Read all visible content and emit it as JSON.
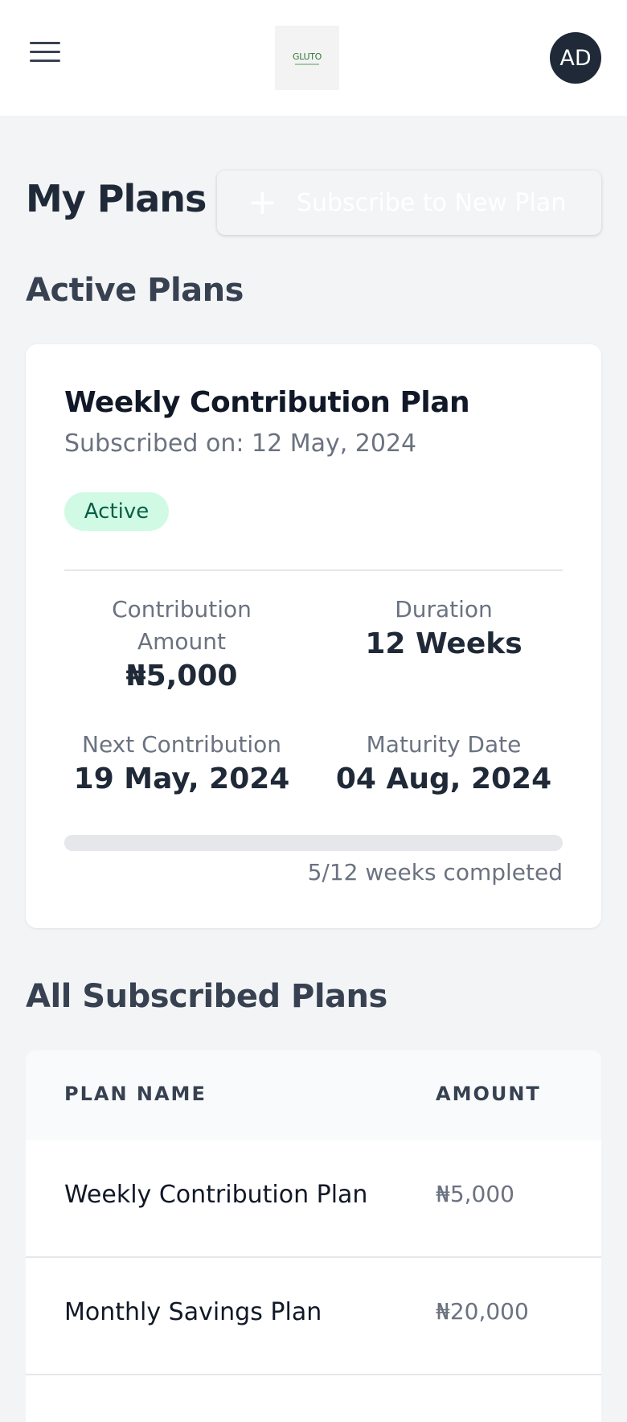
{
  "header": {
    "logo_text": "GLUTO",
    "avatar_initials": "AD"
  },
  "page": {
    "title": "My Plans",
    "subscribe_button": "Subscribe to New Plan"
  },
  "active_section": {
    "title": "Active Plans",
    "plan": {
      "name": "Weekly Contribution Plan",
      "subscribed_on": "Subscribed on: 12 May, 2024",
      "status": "Active",
      "contribution_label_line1": "Contribution",
      "contribution_label_line2": "Amount",
      "contribution_value": "₦5,000",
      "duration_label": "Duration",
      "duration_value": "12 Weeks",
      "next_label": "Next Contribution",
      "next_value": "19 May, 2024",
      "maturity_label": "Maturity Date",
      "maturity_value": "04 Aug, 2024",
      "progress_fraction": 0.4167,
      "progress_text": "5/12 weeks completed"
    }
  },
  "all_section": {
    "title": "All Subscribed Plans",
    "columns": [
      "PLAN NAME",
      "AMOUNT"
    ],
    "rows": [
      {
        "name": "Weekly Contribution Plan",
        "amount": "₦5,000"
      },
      {
        "name": "Monthly Savings Plan",
        "amount": "₦20,000"
      }
    ]
  },
  "colors": {
    "badge_bg": "#d1fae5",
    "badge_text": "#065f46",
    "avatar_bg": "#1f2937"
  }
}
